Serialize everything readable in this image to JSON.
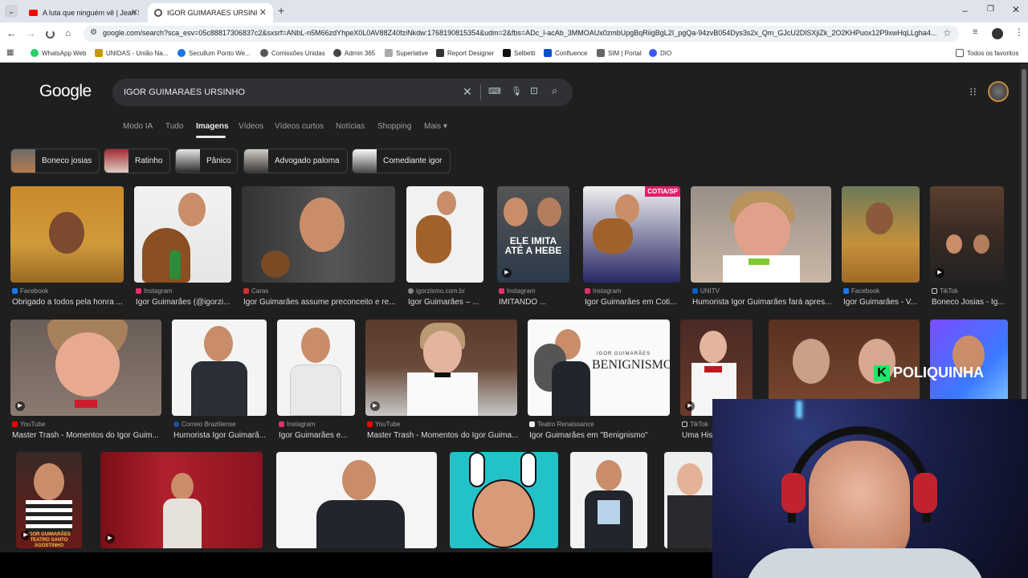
{
  "browser": {
    "tabs": [
      {
        "title": "A luta que ninguém vê | Jean S",
        "icon": "youtube-icon",
        "active": false
      },
      {
        "title": "IGOR GUIMARAES URSINHO - G",
        "icon": "google-icon",
        "active": true
      }
    ],
    "new_tab": "+",
    "url": "google.com/search?sca_esv=05c88817306837c2&sxsrf=ANbL-n5M66zdYhpeX0L0AV88Z40fziNkdw:1768190815354&udm=2&fbs=ADc_l-acAb_3MMOAUx0zmbUpgBqRiigBgL2I_pgQa-94zvB054Dys3s2x_Qm_GJcU2DlSXjiZk_2O2KHPuox12P9xwHqLLgha4...",
    "bookmarks": [
      "WhatsApp Web",
      "UNIDAS - União Na...",
      "Secullum Ponto We...",
      "Comissões Unidas",
      "Admin 365",
      "Superlative",
      "Report Designer",
      "Selbetti",
      "Confluence",
      "SIM | Portal",
      "DIO"
    ],
    "all_bookmarks": "Todos os favoritos"
  },
  "google": {
    "logo": "Google",
    "query": "IGOR GUIMARAES URSINHO",
    "nav": [
      "Modo IA",
      "Tudo",
      "Imagens",
      "Vídeos",
      "Vídeos curtos",
      "Notícias",
      "Shopping",
      "Mais"
    ],
    "active_nav": "Imagens",
    "chips": [
      "Boneco josias",
      "Ratinho",
      "Pânico",
      "Advogado paloma",
      "Comediante igor"
    ]
  },
  "results": {
    "row1": [
      {
        "source": "Facebook",
        "title": "Obrigado a todos pela honra ..."
      },
      {
        "source": "Instagram",
        "title": "Igor Guimarães (@igorzi..."
      },
      {
        "source": "Caras",
        "title": "Igor Guimarães assume preconceito e re..."
      },
      {
        "source": "igorzismo.com.br",
        "title": "Igor Guimarães – ..."
      },
      {
        "source": "Instagram",
        "title": "IMITANDO ...",
        "overlay": "ELE IMITA ATÉ A HEBE"
      },
      {
        "source": "Instagram",
        "title": "Igor Guimarães em Coti...",
        "overlay": "COTIA/SP"
      },
      {
        "source": "UNITV",
        "title": "Humorista Igor Guimarães fará apres..."
      },
      {
        "source": "Facebook",
        "title": "Igor Guimarães - V..."
      },
      {
        "source": "TikTok",
        "title": "Boneco Josias - Ig..."
      }
    ],
    "row2": [
      {
        "source": "YouTube",
        "title": "Master Trash - Momentos do Igor Guim..."
      },
      {
        "source": "Correio Braziliense",
        "title": "Humorista Igor Guimarã..."
      },
      {
        "source": "Instagram",
        "title": "Igor Guimarães e..."
      },
      {
        "source": "YouTube",
        "title": "Master Trash - Momentos do Igor Guima..."
      },
      {
        "source": "Teatro Renaissance",
        "title": "Igor Guimarães em \"Benignismo\"",
        "overlay": "BENIGNISMO",
        "overlay_small": "IGOR GUIMARÃES"
      },
      {
        "source": "TikTok",
        "title": "Uma His"
      },
      {
        "source": "",
        "title": ""
      },
      {
        "source": "",
        "title": "",
        "overlay": "POLIQUINHA"
      }
    ],
    "row3_overlays": [
      "IGOR GUIMARÃES",
      "TEATRO SANTO AGOSTINHO"
    ]
  }
}
